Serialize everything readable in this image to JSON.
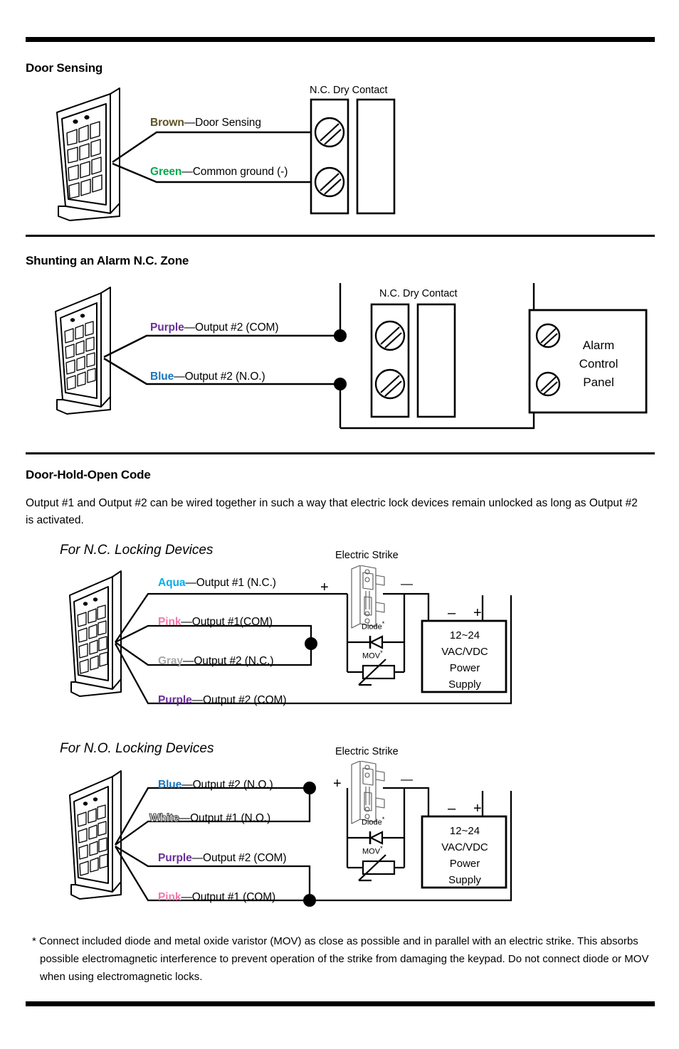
{
  "document": {
    "sections": [
      {
        "id": "door-sensing",
        "title": "Door Sensing",
        "terminal_caption": "N.C. Dry Contact",
        "wires": [
          {
            "color_name": "Brown",
            "color_hex": "#5c5220",
            "function": "—Door Sensing"
          },
          {
            "color_name": "Green",
            "color_hex": "#00a94f",
            "function": "—Common ground (-)"
          }
        ]
      },
      {
        "id": "shunting-alarm",
        "title": "Shunting an Alarm N.C. Zone",
        "terminal_caption": "N.C. Dry Contact",
        "panel_label_line1": "Alarm",
        "panel_label_line2": "Control",
        "panel_label_line3": "Panel",
        "wires": [
          {
            "color_name": "Purple",
            "color_hex": "#6a2f98",
            "function": "—Output #2 (COM)"
          },
          {
            "color_name": "Blue",
            "color_hex": "#1b75bc",
            "function": "—Output #2 (N.O.)"
          }
        ]
      },
      {
        "id": "door-hold-open",
        "title": "Door-Hold-Open Code",
        "paragraph": "Output #1 and Output #2 can be wired together in such a way that electric lock devices remain unlocked as long as Output #2 is activated.",
        "subdiagrams": [
          {
            "id": "nc-locking",
            "title": "For N.C. Locking Devices",
            "strike_caption": "Electric Strike",
            "diode_caption": "Diode",
            "mov_caption": "MOV",
            "footnote_marker": "*",
            "strike_plus": "+",
            "strike_minus": "—",
            "supply_minus": "–",
            "supply_plus": "+",
            "power_supply_lines": [
              "12~24",
              "VAC/VDC",
              "Power",
              "Supply"
            ],
            "wires": [
              {
                "color_name": "Aqua",
                "color_hex": "#00aeef",
                "function": "—Output #1 (N.C.)"
              },
              {
                "color_name": "Pink",
                "color_hex": "#f578ab",
                "function": "—Output #1(COM)"
              },
              {
                "color_name": "Gray",
                "color_hex": "#a9a9a9",
                "function": "—Output #2 (N.C.)"
              },
              {
                "color_name": "Purple",
                "color_hex": "#6a2f98",
                "function": "—Output #2 (COM)"
              }
            ]
          },
          {
            "id": "no-locking",
            "title": "For N.O. Locking Devices",
            "strike_caption": "Electric Strike",
            "diode_caption": "Diode",
            "mov_caption": "MOV",
            "footnote_marker": "*",
            "strike_plus": "+",
            "strike_minus": "—",
            "supply_minus": "–",
            "supply_plus": "+",
            "power_supply_lines": [
              "12~24",
              "VAC/VDC",
              "Power",
              "Supply"
            ],
            "wires": [
              {
                "color_name": "Blue",
                "color_hex": "#1b75bc",
                "function": "—Output #2 (N.O.)"
              },
              {
                "color_name": "White",
                "color_hex": "#ffffff",
                "function": "—Output #1 (N.O.)"
              },
              {
                "color_name": "Purple",
                "color_hex": "#6a2f98",
                "function": "—Output #2 (COM)"
              },
              {
                "color_name": "Pink",
                "color_hex": "#f578ab",
                "function": "—Output #1 (COM)"
              }
            ]
          }
        ]
      }
    ],
    "footnote": "* Connect included diode and metal oxide varistor (MOV) as close as possible and in parallel with an electric strike.  This absorbs possible electromagnetic interference to prevent operation of the strike from damaging the keypad.  Do not connect diode or MOV when using electromagnetic locks."
  }
}
